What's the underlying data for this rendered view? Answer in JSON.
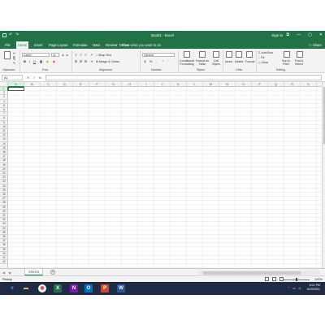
{
  "window": {
    "title": "Book1 - Excel",
    "sign_in": "Sign in",
    "controls": [
      "—",
      "▢",
      "⧉",
      "✕"
    ]
  },
  "tabs": [
    "File",
    "Home",
    "Insert",
    "Page Layout",
    "Formulas",
    "Data",
    "Review",
    "View"
  ],
  "active_tab": "Home",
  "tell_me": "Tell me what you want to do",
  "share": "Share",
  "ribbon": {
    "font_name": "Calibri",
    "font_size": "11",
    "wrap_text": "Wrap Text",
    "merge_center": "Merge & Center",
    "number_format": "General",
    "conditional_formatting": "Conditional Formatting",
    "format_as_table": "Format as Table",
    "cell_styles": "Cell Styles",
    "insert": "Insert",
    "delete": "Delete",
    "format": "Format",
    "autosum": "AutoSum",
    "fill": "Fill",
    "clear": "Clear",
    "sort_filter": "Sort & Filter",
    "find_select": "Find & Select",
    "groups": [
      "Clipboard",
      "Font",
      "Alignment",
      "Number",
      "Styles",
      "Cells",
      "Editing"
    ]
  },
  "formula_bar": {
    "name_box": "A1",
    "value": ""
  },
  "columns": [
    "A",
    "B",
    "C",
    "D",
    "E",
    "F",
    "G",
    "H",
    "I",
    "J",
    "K",
    "L",
    "M",
    "N",
    "O",
    "P",
    "Q",
    "R",
    "S"
  ],
  "rows": [
    "1",
    "2",
    "3",
    "4",
    "5",
    "6",
    "7",
    "8",
    "9",
    "10",
    "11",
    "12",
    "13",
    "14",
    "15",
    "16",
    "17",
    "18",
    "19",
    "20",
    "21",
    "22",
    "23",
    "24",
    "25",
    "26",
    "27",
    "28",
    "29",
    "30",
    "31",
    "32",
    "33",
    "34",
    "35",
    "36",
    "37",
    "38",
    "39",
    "40",
    "41",
    "42"
  ],
  "selected_cell": "A1",
  "sheets": [
    "Sheet1"
  ],
  "status": {
    "ready": "Ready",
    "zoom": "100%"
  },
  "taskbar": {
    "time": "6:01 PM",
    "date": "6/29/2021"
  }
}
